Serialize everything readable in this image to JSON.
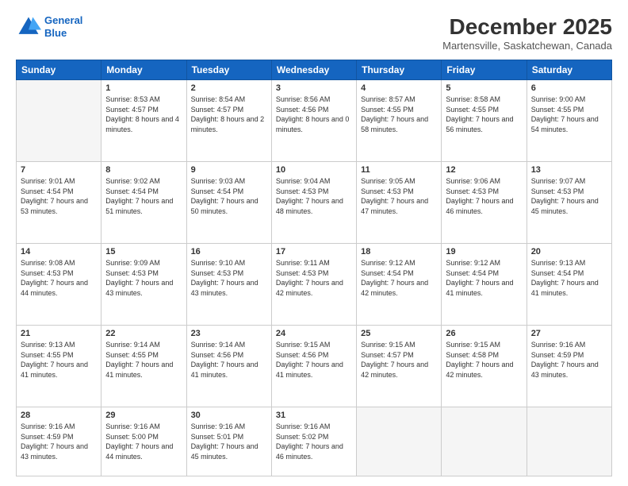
{
  "header": {
    "logo_line1": "General",
    "logo_line2": "Blue",
    "month_title": "December 2025",
    "location": "Martensville, Saskatchewan, Canada"
  },
  "weekdays": [
    "Sunday",
    "Monday",
    "Tuesday",
    "Wednesday",
    "Thursday",
    "Friday",
    "Saturday"
  ],
  "weeks": [
    [
      {
        "day": "",
        "empty": true
      },
      {
        "day": "1",
        "rise": "8:53 AM",
        "set": "4:57 PM",
        "daylight": "8 hours and 4 minutes."
      },
      {
        "day": "2",
        "rise": "8:54 AM",
        "set": "4:57 PM",
        "daylight": "8 hours and 2 minutes."
      },
      {
        "day": "3",
        "rise": "8:56 AM",
        "set": "4:56 PM",
        "daylight": "8 hours and 0 minutes."
      },
      {
        "day": "4",
        "rise": "8:57 AM",
        "set": "4:55 PM",
        "daylight": "7 hours and 58 minutes."
      },
      {
        "day": "5",
        "rise": "8:58 AM",
        "set": "4:55 PM",
        "daylight": "7 hours and 56 minutes."
      },
      {
        "day": "6",
        "rise": "9:00 AM",
        "set": "4:55 PM",
        "daylight": "7 hours and 54 minutes."
      }
    ],
    [
      {
        "day": "7",
        "rise": "9:01 AM",
        "set": "4:54 PM",
        "daylight": "7 hours and 53 minutes."
      },
      {
        "day": "8",
        "rise": "9:02 AM",
        "set": "4:54 PM",
        "daylight": "7 hours and 51 minutes."
      },
      {
        "day": "9",
        "rise": "9:03 AM",
        "set": "4:54 PM",
        "daylight": "7 hours and 50 minutes."
      },
      {
        "day": "10",
        "rise": "9:04 AM",
        "set": "4:53 PM",
        "daylight": "7 hours and 48 minutes."
      },
      {
        "day": "11",
        "rise": "9:05 AM",
        "set": "4:53 PM",
        "daylight": "7 hours and 47 minutes."
      },
      {
        "day": "12",
        "rise": "9:06 AM",
        "set": "4:53 PM",
        "daylight": "7 hours and 46 minutes."
      },
      {
        "day": "13",
        "rise": "9:07 AM",
        "set": "4:53 PM",
        "daylight": "7 hours and 45 minutes."
      }
    ],
    [
      {
        "day": "14",
        "rise": "9:08 AM",
        "set": "4:53 PM",
        "daylight": "7 hours and 44 minutes."
      },
      {
        "day": "15",
        "rise": "9:09 AM",
        "set": "4:53 PM",
        "daylight": "7 hours and 43 minutes."
      },
      {
        "day": "16",
        "rise": "9:10 AM",
        "set": "4:53 PM",
        "daylight": "7 hours and 43 minutes."
      },
      {
        "day": "17",
        "rise": "9:11 AM",
        "set": "4:53 PM",
        "daylight": "7 hours and 42 minutes."
      },
      {
        "day": "18",
        "rise": "9:12 AM",
        "set": "4:54 PM",
        "daylight": "7 hours and 42 minutes."
      },
      {
        "day": "19",
        "rise": "9:12 AM",
        "set": "4:54 PM",
        "daylight": "7 hours and 41 minutes."
      },
      {
        "day": "20",
        "rise": "9:13 AM",
        "set": "4:54 PM",
        "daylight": "7 hours and 41 minutes."
      }
    ],
    [
      {
        "day": "21",
        "rise": "9:13 AM",
        "set": "4:55 PM",
        "daylight": "7 hours and 41 minutes."
      },
      {
        "day": "22",
        "rise": "9:14 AM",
        "set": "4:55 PM",
        "daylight": "7 hours and 41 minutes."
      },
      {
        "day": "23",
        "rise": "9:14 AM",
        "set": "4:56 PM",
        "daylight": "7 hours and 41 minutes."
      },
      {
        "day": "24",
        "rise": "9:15 AM",
        "set": "4:56 PM",
        "daylight": "7 hours and 41 minutes."
      },
      {
        "day": "25",
        "rise": "9:15 AM",
        "set": "4:57 PM",
        "daylight": "7 hours and 42 minutes."
      },
      {
        "day": "26",
        "rise": "9:15 AM",
        "set": "4:58 PM",
        "daylight": "7 hours and 42 minutes."
      },
      {
        "day": "27",
        "rise": "9:16 AM",
        "set": "4:59 PM",
        "daylight": "7 hours and 43 minutes."
      }
    ],
    [
      {
        "day": "28",
        "rise": "9:16 AM",
        "set": "4:59 PM",
        "daylight": "7 hours and 43 minutes."
      },
      {
        "day": "29",
        "rise": "9:16 AM",
        "set": "5:00 PM",
        "daylight": "7 hours and 44 minutes."
      },
      {
        "day": "30",
        "rise": "9:16 AM",
        "set": "5:01 PM",
        "daylight": "7 hours and 45 minutes."
      },
      {
        "day": "31",
        "rise": "9:16 AM",
        "set": "5:02 PM",
        "daylight": "7 hours and 46 minutes."
      },
      {
        "day": "",
        "empty": true
      },
      {
        "day": "",
        "empty": true
      },
      {
        "day": "",
        "empty": true
      }
    ]
  ]
}
